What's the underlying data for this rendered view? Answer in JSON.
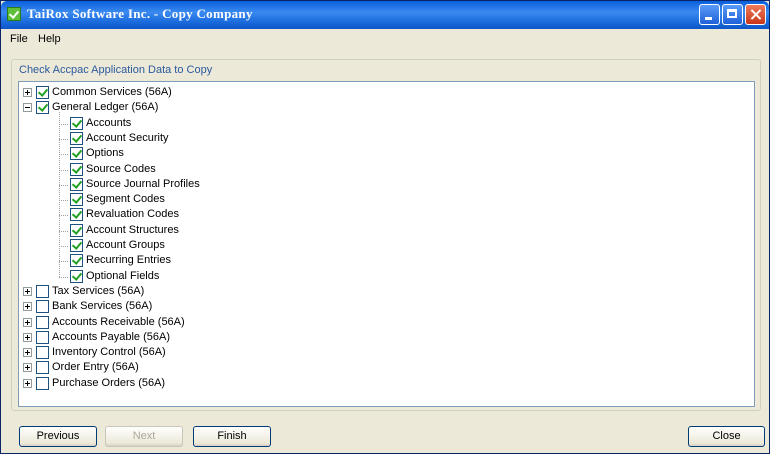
{
  "window": {
    "title": "TaiRox Software Inc. - Copy Company"
  },
  "menu": [
    "File",
    "Help"
  ],
  "group_label": "Check Accpac Application Data to Copy",
  "tree": {
    "root_items": [
      {
        "label": "Common Services (56A)",
        "checked": true,
        "expander": "plus"
      },
      {
        "label": "General Ledger (56A)",
        "checked": true,
        "expander": "minus"
      }
    ],
    "gl_children": [
      {
        "label": "Accounts",
        "checked": true
      },
      {
        "label": "Account Security",
        "checked": true
      },
      {
        "label": "Options",
        "checked": true
      },
      {
        "label": "Source Codes",
        "checked": true
      },
      {
        "label": "Source Journal Profiles",
        "checked": true
      },
      {
        "label": "Segment Codes",
        "checked": true
      },
      {
        "label": "Revaluation Codes",
        "checked": true
      },
      {
        "label": "Account Structures",
        "checked": true
      },
      {
        "label": "Account Groups",
        "checked": true
      },
      {
        "label": "Recurring Entries",
        "checked": true
      },
      {
        "label": "Optional Fields",
        "checked": true
      }
    ],
    "other_items": [
      {
        "label": "Tax Services (56A)",
        "checked": false,
        "expander": "plus"
      },
      {
        "label": "Bank Services (56A)",
        "checked": false,
        "expander": "plus"
      },
      {
        "label": "Accounts Receivable (56A)",
        "checked": false,
        "expander": "plus"
      },
      {
        "label": "Accounts Payable (56A)",
        "checked": false,
        "expander": "plus"
      },
      {
        "label": "Inventory Control (56A)",
        "checked": false,
        "expander": "plus"
      },
      {
        "label": "Order Entry (56A)",
        "checked": false,
        "expander": "plus"
      },
      {
        "label": "Purchase Orders (56A)",
        "checked": false,
        "expander": "plus"
      }
    ]
  },
  "buttons": {
    "previous": "Previous",
    "next": "Next",
    "finish": "Finish",
    "close": "Close"
  }
}
